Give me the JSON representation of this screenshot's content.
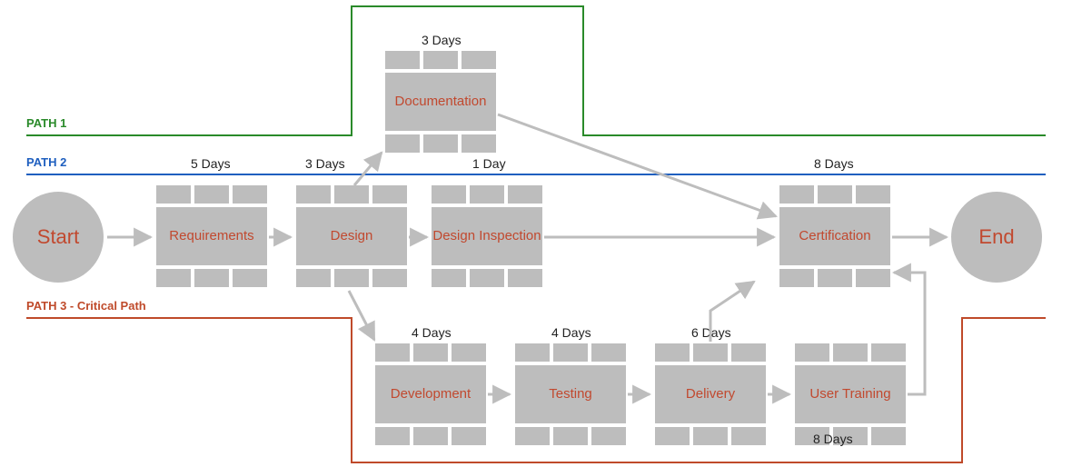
{
  "paths": {
    "p1": {
      "label": "PATH 1",
      "color": "#2a8a2a"
    },
    "p2": {
      "label": "PATH 2",
      "color": "#1f5fbf"
    },
    "p3": {
      "label": "PATH 3 - Critical Path",
      "color": "#bf4a2a"
    }
  },
  "endpoints": {
    "start": "Start",
    "end": "End"
  },
  "tasks": {
    "requirements": {
      "label": "Requirements",
      "days": "5 Days"
    },
    "design": {
      "label": "Design",
      "days": "3 Days"
    },
    "documentation": {
      "label": "Documentation",
      "days": "3 Days"
    },
    "inspection": {
      "label": "Design Inspection",
      "days": "1 Day"
    },
    "development": {
      "label": "Development",
      "days": "4 Days"
    },
    "testing": {
      "label": "Testing",
      "days": "4 Days"
    },
    "delivery": {
      "label": "Delivery",
      "days": "6 Days"
    },
    "training": {
      "label": "User Training",
      "days": "8 Days"
    },
    "certification": {
      "label": "Certification",
      "days": "8 Days"
    }
  }
}
